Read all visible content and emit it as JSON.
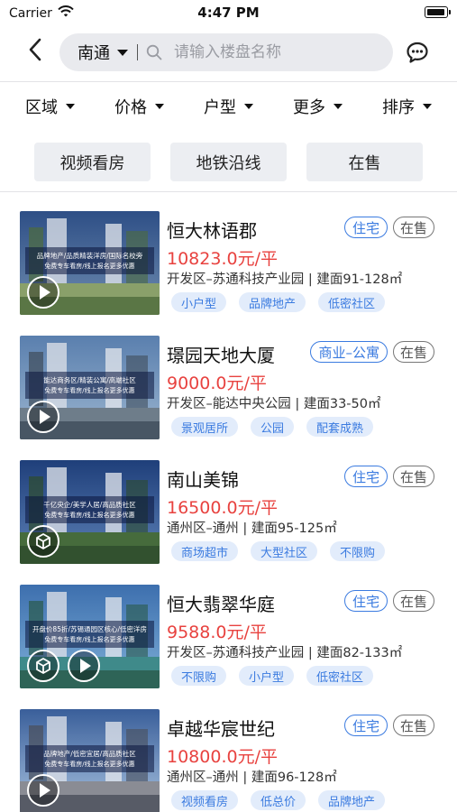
{
  "status_bar": {
    "carrier": "Carrier",
    "time": "4:47 PM",
    "battery_level": 0.95
  },
  "header": {
    "city": "南通",
    "search_placeholder": "请输入楼盘名称",
    "icons": {
      "back": "chevron-left-icon",
      "search": "search-icon",
      "message": "chat-bubble-icon"
    }
  },
  "filters": [
    {
      "label": "区域"
    },
    {
      "label": "价格"
    },
    {
      "label": "户型"
    },
    {
      "label": "更多"
    },
    {
      "label": "排序"
    }
  ],
  "quick_tags": [
    {
      "label": "视频看房"
    },
    {
      "label": "地铁沿线"
    },
    {
      "label": "在售"
    }
  ],
  "colors": {
    "price": "#e8423f",
    "accent": "#3b7be0",
    "tag_bg": "#e2ecfb",
    "chip_bg": "#eceef2"
  },
  "listings": [
    {
      "title": "恒大林语郡",
      "price": "10823.0元/平",
      "location": "开发区–苏通科技产业园 | 建面91-128㎡",
      "type": "住宅",
      "status": "在售",
      "tags": [
        "小户型",
        "品牌地产",
        "低密社区"
      ],
      "media_icons": [
        "play-icon"
      ],
      "thumb_text1": "品牌地产/品质精装洋房/国际名校旁",
      "thumb_text2": "免费专车看房/线上报名更多优惠"
    },
    {
      "title": "璟园天地大厦",
      "price": "9000.0元/平",
      "location": "开发区–能达中央公园 | 建面33-50㎡",
      "type": "商业–公寓",
      "status": "在售",
      "tags": [
        "景观居所",
        "公园",
        "配套成熟"
      ],
      "media_icons": [
        "play-icon"
      ],
      "thumb_text1": "能达商务区/精装公寓/高端社区",
      "thumb_text2": "免费专车看房/线上报名更多优惠"
    },
    {
      "title": "南山美锦",
      "price": "16500.0元/平",
      "location": "通州区–通州 | 建面95-125㎡",
      "type": "住宅",
      "status": "在售",
      "tags": [
        "商场超市",
        "大型社区",
        "不限购"
      ],
      "media_icons": [
        "vr-cube-icon"
      ],
      "thumb_text1": "千亿央企/美学人居/高品质社区",
      "thumb_text2": "免费专车看房/线上报名更多优惠"
    },
    {
      "title": "恒大翡翠华庭",
      "price": "9588.0元/平",
      "location": "开发区–苏通科技产业园 | 建面82-133㎡",
      "type": "住宅",
      "status": "在售",
      "tags": [
        "不限购",
        "小户型",
        "低密社区"
      ],
      "media_icons": [
        "vr-cube-icon",
        "play-icon"
      ],
      "thumb_text1": "开盘价85折/苏锡通园区核心/低密洋房",
      "thumb_text2": "免费专车看房/线上报名更多优惠"
    },
    {
      "title": "卓越华宸世纪",
      "price": "10800.0元/平",
      "location": "通州区–通州 | 建面96-128㎡",
      "type": "住宅",
      "status": "在售",
      "tags": [
        "视频看房",
        "低总价",
        "品牌地产"
      ],
      "media_icons": [
        "play-icon"
      ],
      "thumb_text1": "品牌地产/低密宜居/高品质社区",
      "thumb_text2": "免费专车看房/线上报名更多优惠"
    }
  ]
}
